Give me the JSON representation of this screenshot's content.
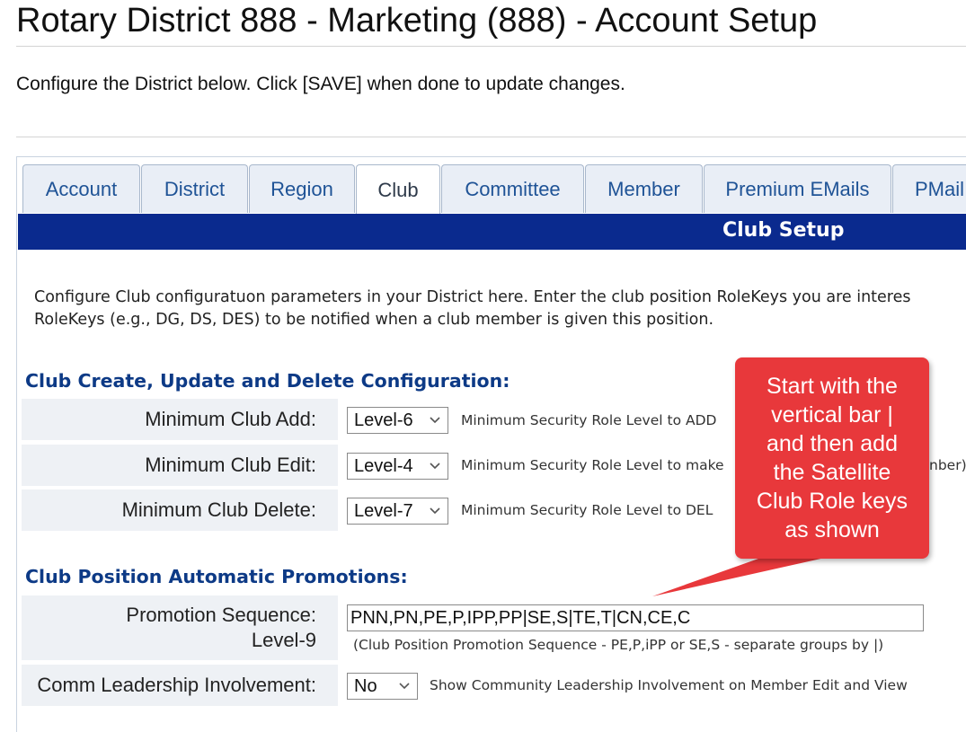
{
  "page": {
    "title": "Rotary District 888 - Marketing (888) - Account Setup",
    "intro": "Configure the District below. Click [SAVE] when done to update changes."
  },
  "tabs": [
    {
      "label": "Account"
    },
    {
      "label": "District"
    },
    {
      "label": "Region"
    },
    {
      "label": "Club",
      "active": true
    },
    {
      "label": "Committee"
    },
    {
      "label": "Member"
    },
    {
      "label": "Premium EMails"
    },
    {
      "label": "PMail"
    }
  ],
  "setup": {
    "title": "Club Setup",
    "desc_line1": "Configure Club configuratuon parameters in your District here. Enter the club position RoleKeys you are interes",
    "desc_line2": "RoleKeys (e.g., DG, DS, DES) to be notified when a club member is given this position."
  },
  "section_crud": {
    "title": "Club Create, Update and Delete Configuration:",
    "rows": [
      {
        "label": "Minimum Club Add:",
        "value": "Level-6",
        "hint": "Minimum Security Role Level to ADD"
      },
      {
        "label": "Minimum Club Edit:",
        "value": "Level-4",
        "hint": "Minimum Security Role Level to make",
        "hint_tail": "nber)"
      },
      {
        "label": "Minimum Club Delete:",
        "value": "Level-7",
        "hint": "Minimum Security Role Level to DEL"
      }
    ]
  },
  "section_promo": {
    "title": "Club Position Automatic Promotions:",
    "sequence_label": "Promotion Sequence:",
    "sequence_level": "Level-9",
    "sequence_value": "PNN,PN,PE,P,IPP,PP|SE,S|TE,T|CN,CE,C",
    "sequence_hint": "(Club Position Promotion Sequence - PE,P,iPP or SE,S - separate groups by |)",
    "comm_label": "Comm Leadership Involvement:",
    "comm_value": "No",
    "comm_hint": "Show Community Leadership Involvement on Member Edit and View"
  },
  "callout": {
    "lines": [
      "Start with the",
      "vertical bar |",
      "and then add",
      "the Satellite",
      "Club Role keys",
      "as shown"
    ]
  },
  "colors": {
    "header_bar": "#0a2a8e",
    "section_title": "#0d3a86",
    "tab_text": "#1f5396",
    "callout": "#e8383b"
  },
  "icons": {
    "dropdown": "chevron-down-icon"
  }
}
